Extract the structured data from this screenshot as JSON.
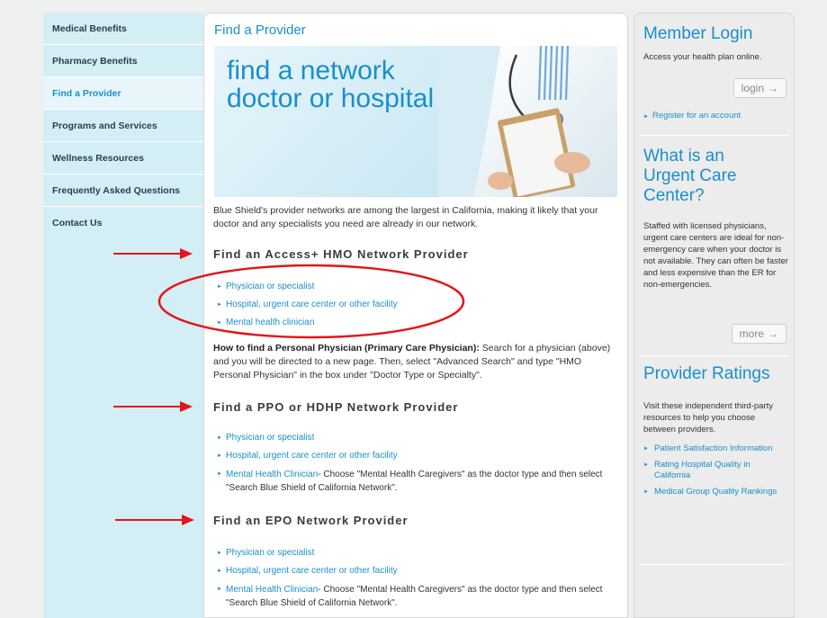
{
  "leftnav": {
    "items": [
      {
        "label": "Medical Benefits",
        "active": false
      },
      {
        "label": "Pharmacy Benefits",
        "active": false
      },
      {
        "label": "Find a Provider",
        "active": true
      },
      {
        "label": "Programs and Services",
        "active": false
      },
      {
        "label": "Wellness Resources",
        "active": false
      },
      {
        "label": "Frequently Asked Questions",
        "active": false
      },
      {
        "label": "Contact Us",
        "active": false
      }
    ]
  },
  "main": {
    "title": "Find a Provider",
    "banner_line1": "find a network",
    "banner_line2": "doctor or hospital",
    "intro": "Blue Shield's provider networks are among the largest in California, making it likely that your doctor and any specialists you need are already in our network.",
    "sections": [
      {
        "heading": "Find an Access+ HMO Network Provider",
        "links": [
          {
            "label": "Physician or specialist"
          },
          {
            "label": "Hospital, urgent care center or other facility"
          },
          {
            "label": "Mental health clinician"
          }
        ]
      },
      {
        "heading": "Find a PPO or HDHP Network Provider",
        "links": [
          {
            "label": "Physician or specialist"
          },
          {
            "label": "Hospital, urgent care center or other facility"
          },
          {
            "label": "Mental Health Clinician",
            "rest": "- Choose \"Mental Health Caregivers\" as the doctor type and then select \"Search Blue Shield of California Network\"."
          }
        ]
      },
      {
        "heading": "Find an EPO Network Provider",
        "links": [
          {
            "label": "Physician or specialist"
          },
          {
            "label": "Hospital, urgent care center or other facility"
          },
          {
            "label": "Mental Health Clinician",
            "rest": "- Choose \"Mental Health Caregivers\" as the doctor type and then select \"Search Blue Shield of California Network\"."
          }
        ]
      }
    ],
    "howto_bold": "How to find a Personal Physician (Primary Care Physician):",
    "howto_rest": " Search for a physician (above) and you will be directed to a new page. Then, select \"Advanced Search\" and type \"HMO Personal Physician\" in the box under \"Doctor Type or Specialty\"."
  },
  "sidebar": {
    "login_title": "Member Login",
    "login_text": "Access your health plan online.",
    "login_button": "login",
    "register_link": "Register for an account",
    "urgent_title_1": "What is an",
    "urgent_title_2": "Urgent Care",
    "urgent_title_3": "Center?",
    "urgent_text": "Staffed with licensed physicians, urgent care centers are ideal for non-emergency care when your doctor is not available. They can often be faster and less expensive than the ER for non-emergencies.",
    "more_button": "more",
    "ratings_title": "Provider Ratings",
    "ratings_text": "Visit these independent third-party resources to help you choose between providers.",
    "ratings_links": [
      "Patient Satisfaction Information",
      "Rating Hospital Quality in California",
      "Medical Group Quality Rankings"
    ]
  },
  "icons": {
    "button_arrow": "arrow-right-icon",
    "list_bullet": "triangle-bullet-icon"
  },
  "colors": {
    "accent": "#1a8fc9",
    "nav_bg": "#d4eef6",
    "annotation": "#e2161a"
  }
}
